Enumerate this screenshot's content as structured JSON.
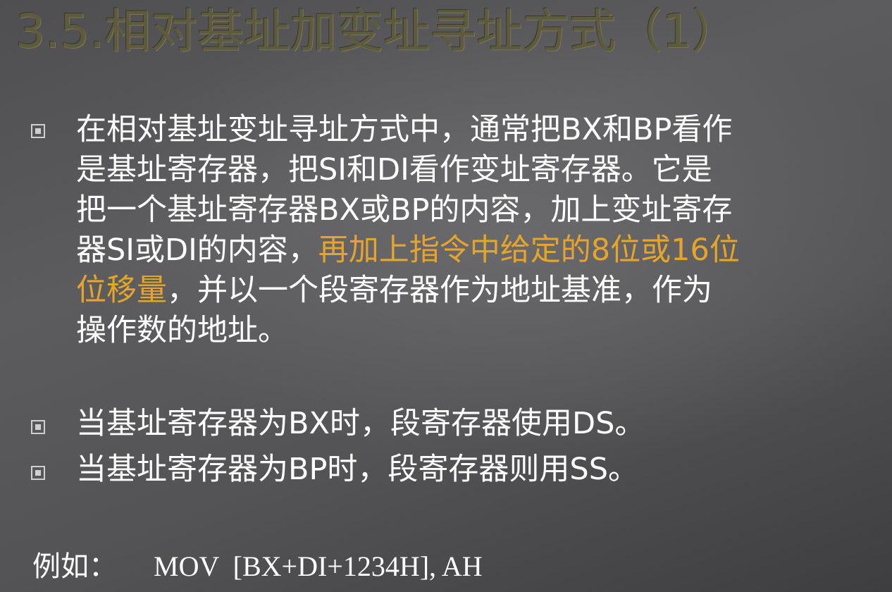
{
  "title": "3.5.相对基址加变址寻址方式（1）",
  "bullet1": {
    "lines": [
      "在相对基址变址寻址方式中，通常把BX和BP看作",
      "是基址寄存器，把SI和DI看作变址寄存器。它是",
      "把一个基址寄存器BX或BP的内容，加上变址寄存"
    ],
    "line4_pre": "器SI或DI的内容，",
    "line4_hl": "再加上指令中给定的8位或16位",
    "line5_hl": "位移量",
    "line5_post": "，并以一个段寄存器作为地址基准，作为",
    "line6": "操作数的地址。"
  },
  "bullet2": "当基址寄存器为BX时，段寄存器使用DS。",
  "bullet3": "当基址寄存器为BP时，段寄存器则用SS。",
  "example": {
    "label": "例如：",
    "code": "MOV  [BX+DI+1234H], AH"
  },
  "colors": {
    "highlight": "#e6a52a",
    "title": "#5e5a3e",
    "text": "#ffffff"
  }
}
